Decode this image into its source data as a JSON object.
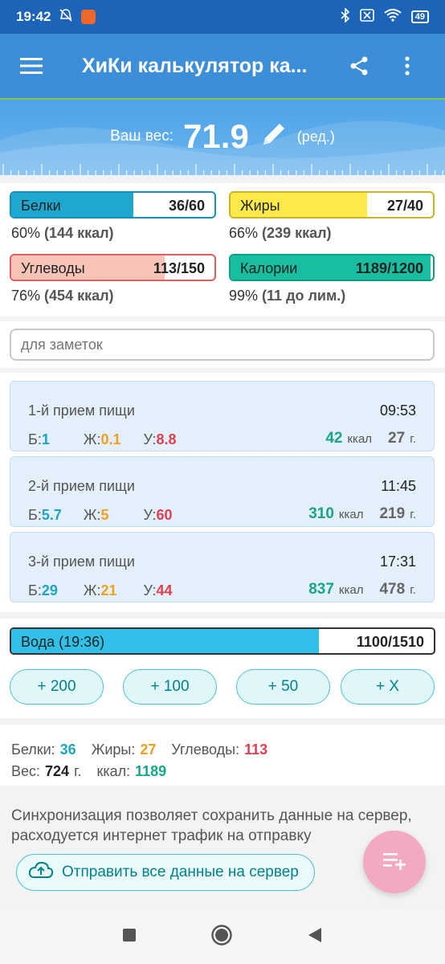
{
  "status_bar": {
    "time": "19:42",
    "battery": "49"
  },
  "app_bar": {
    "title": "ХиКи калькулятор ка...",
    "menu_icon": "hamburger-menu-icon",
    "share_icon": "share-icon",
    "more_icon": "more-vert-icon"
  },
  "weight": {
    "label": "Ваш вес:",
    "value": "71.9",
    "edit_label": "(ред.)"
  },
  "macros": {
    "protein": {
      "name": "Белки",
      "value": "36/60",
      "sub_pct": "60%",
      "sub_kcal": "(144 ккал)",
      "fill": 0.6,
      "color": "#1fa8cf"
    },
    "fat": {
      "name": "Жиры",
      "value": "27/40",
      "sub_pct": "66%",
      "sub_kcal": "(239 ккал)",
      "fill": 0.675,
      "color": "#fde94a"
    },
    "carbs": {
      "name": "Углеводы",
      "value": "113/150",
      "sub_pct": "76%",
      "sub_kcal": "(454 ккал)",
      "fill": 0.753,
      "color": "#f8c4b8"
    },
    "calories": {
      "name": "Калории",
      "value": "1189/1200",
      "sub_pct": "99%",
      "sub_kcal": "(11 до лим.)",
      "fill": 0.99,
      "color": "#17bea0"
    }
  },
  "notes": {
    "placeholder": "для заметок"
  },
  "meals": [
    {
      "title": "1-й прием пищи",
      "time": "09:53",
      "b_label": "Б:",
      "b": "1",
      "z_label": "Ж:",
      "z": "0.1",
      "u_label": "У:",
      "u": "8.8",
      "kcal": "42",
      "kcal_unit": "ккал",
      "grams": "27",
      "grams_unit": "г."
    },
    {
      "title": "2-й прием пищи",
      "time": "11:45",
      "b_label": "Б:",
      "b": "5.7",
      "z_label": "Ж:",
      "z": "5",
      "u_label": "У:",
      "u": "60",
      "kcal": "310",
      "kcal_unit": "ккал",
      "grams": "219",
      "grams_unit": "г."
    },
    {
      "title": "3-й прием пищи",
      "time": "17:31",
      "b_label": "Б:",
      "b": "29",
      "z_label": "Ж:",
      "z": "21",
      "u_label": "У:",
      "u": "44",
      "kcal": "837",
      "kcal_unit": "ккал",
      "grams": "478",
      "grams_unit": "г."
    }
  ],
  "water": {
    "name": "Вода (19:36)",
    "value": "1100/1510",
    "fill": 0.728,
    "buttons": [
      "+ 200",
      "+ 100",
      "+ 50",
      "+ X"
    ]
  },
  "summary": {
    "protein_label": "Белки:",
    "protein": "36",
    "fat_label": "Жиры:",
    "fat": "27",
    "carbs_label": "Углеводы:",
    "carbs": "113",
    "weight_label": "Вес:",
    "weight": "724",
    "weight_unit": "г.",
    "kcal_label": "ккал:",
    "kcal": "1189"
  },
  "sync": {
    "text": "Синхронизация позволяет сохранить данные на сервер, расходуется интернет трафик на отправку",
    "button": "Отправить все данные на сервер"
  },
  "colors": {
    "appbar": "#3c8ed9",
    "statusbar": "#1c64b8",
    "protein": "#1fa5c4",
    "fat": "#f0a020",
    "carbs": "#e0404e",
    "kcal": "#17a589",
    "fab": "#f4a9c3"
  }
}
